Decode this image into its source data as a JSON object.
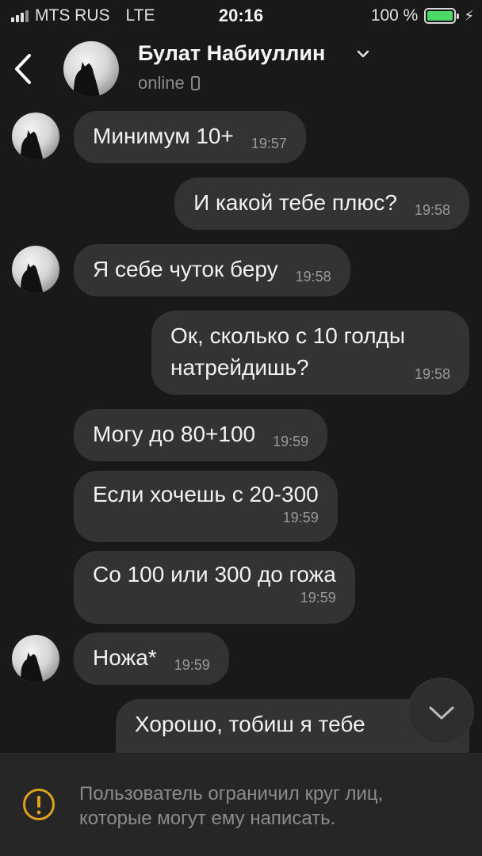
{
  "status_bar": {
    "carrier": "MTS RUS",
    "network": "LTE",
    "time": "20:16",
    "battery_text": "100 %",
    "battery_level": 1.0,
    "battery_color": "#4cd964"
  },
  "header": {
    "back_icon": "chevron-left-icon",
    "contact_name": "Булат Набиуллин",
    "presence": "online",
    "presence_icon": "mobile-phone-icon",
    "name_icon": "chevron-down-icon"
  },
  "messages": [
    {
      "side": "in",
      "text": "Минимум 10+",
      "time": "19:57",
      "avatar": true
    },
    {
      "side": "out",
      "text": "И какой тебе плюс?",
      "time": "19:58"
    },
    {
      "side": "in",
      "text": "Я себе чуток беру",
      "time": "19:58",
      "avatar": true
    },
    {
      "side": "out",
      "line1": "Ок, сколько с 10 голды",
      "line2": "натрейдишь?",
      "time": "19:58"
    },
    {
      "side": "in",
      "text": "Могу до 80+100",
      "time": "19:59"
    },
    {
      "side": "in",
      "text": "Если хочешь с 20-300",
      "time": "19:59"
    },
    {
      "side": "in",
      "text": "Со 100 или 300 до гожа",
      "time": "19:59"
    },
    {
      "side": "in",
      "text": "Ножа*",
      "time": "19:59",
      "avatar": true
    },
    {
      "side": "out",
      "text": "Хорошо, тобиш я тебе",
      "partial": true
    }
  ],
  "scroll_button": {
    "icon": "chevron-down-icon"
  },
  "footer": {
    "icon": "warning-icon",
    "line1": "Пользователь ограничил круг лиц,",
    "line2": "которые могут ему написать.",
    "accent_color": "#e0a21a"
  }
}
